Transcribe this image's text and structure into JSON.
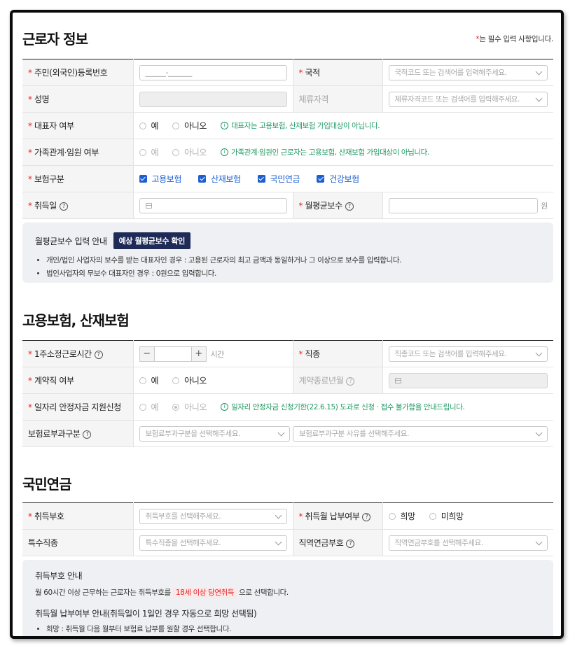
{
  "worker": {
    "title": "근로자 정보",
    "required_note_star": "*",
    "required_note": "는 필수 입력 사항입니다.",
    "rrn_label": "주민(외국인)등록번호",
    "rrn_placeholder": "______-_______",
    "nationality_label": "국적",
    "nationality_placeholder": "국적코드 또는 검색어를 입력해주세요.",
    "name_label": "성명",
    "residence_label": "체류자격",
    "residence_placeholder": "체류자격코드 또는 검색어를 입력해주세요.",
    "ceo_label": "대표자 여부",
    "ceo_yes": "예",
    "ceo_no": "아니오",
    "ceo_info": "대표자는 고용보험, 산재보험 가입대상이 아닙니다.",
    "family_label": "가족관계·임원 여부",
    "family_yes": "예",
    "family_no": "아니오",
    "family_info": "가족관계·임원인 근로자는 고용보험, 산재보험 가입대상이 아닙니다.",
    "insurance_label": "보험구분",
    "insurance_items": [
      "고용보험",
      "산재보험",
      "국민연금",
      "건강보험"
    ],
    "acq_date_label": "취득일",
    "monthly_label": "월평균보수",
    "won": "원"
  },
  "monthly_guide": {
    "title": "월평균보수 입력 안내",
    "button": "예상 월평균보수 확인",
    "items": [
      "개인/법인 사업자의 보수를 받는 대표자인 경우 : 고용된 근로자의 최고 금액과 동일하거나 그 이상으로 보수를 입력합니다.",
      "법인사업자의 무보수 대표자인 경우 : 0원으로 입력합니다."
    ]
  },
  "employment": {
    "title": "고용보험, 산재보험",
    "hours_label": "1주소정근로시간",
    "hours_unit": "시간",
    "job_label": "직종",
    "job_placeholder": "직종코드 또는 검색어를 입력해주세요.",
    "contract_label": "계약직 여부",
    "contract_yes": "예",
    "contract_no": "아니오",
    "contract_end_label": "계약종료년월",
    "subsidy_label": "일자리 안정자금 지원신청",
    "subsidy_yes": "예",
    "subsidy_no": "아니오",
    "subsidy_info": "일자리 안정자금 신청기한(22.6.15) 도과로 신청 · 접수 불가함을 안내드립니다.",
    "premium_label": "보험료부과구분",
    "premium_placeholder": "보험료부과구분을 선택해주세요.",
    "premium_reason_placeholder": "보험료부과구분 사유를 선택해주세요."
  },
  "pension": {
    "title": "국민연금",
    "acq_code_label": "취득부호",
    "acq_code_placeholder": "취득부호를 선택해주세요.",
    "acq_month_label": "취득월 납부여부",
    "hope": "희망",
    "no_hope": "미희망",
    "special_label": "특수직종",
    "special_placeholder": "특수직종을 선택해주세요.",
    "regional_label": "직역연금부호",
    "regional_placeholder": "직역연금부호를 선택해주세요."
  },
  "pension_guide": {
    "title1": "취득부호 안내",
    "text1_pre": "월 60시간 이상 근무하는 근로자는 취득부호를",
    "text1_highlight": "18세 이상 당연취득",
    "text1_post": "으로 선택합니다.",
    "title2": "취득월 납부여부 안내(취득일이 1일인 경우 자동으로 희망 선택됨)",
    "item1": "희망 : 취득월 다음 월부터 보험료 납부를 원할 경우 선택합니다."
  }
}
